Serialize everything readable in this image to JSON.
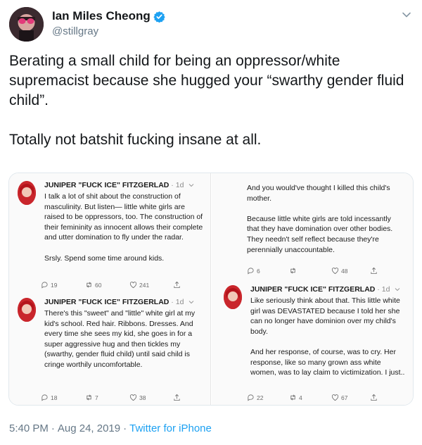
{
  "author": {
    "name": "Ian Miles Cheong",
    "handle": "@stillgray"
  },
  "tweet_text": "Berating a small child for being an oppressor/white supremacist because she hugged your “swarthy gender fluid child”.\n\nTotally not batshit fucking insane at all.",
  "embedded": {
    "author_name": "JUNIPER \"FUCK ICE\" FITZGERLAD",
    "time": "1d",
    "tweet1": {
      "text": "I talk a lot of shit about the construction of masculinity. But listen— little white girls are raised to be oppressors, too. The construction of their femininity as innocent allows their complete and utter domination to fly under the radar.\n\nSrsly. Spend some time around kids.",
      "replies": "19",
      "retweets": "60",
      "likes": "241"
    },
    "tweet2": {
      "text": "There's this \"sweet\" and \"little\" white girl at my kid's school. Red hair. Ribbons. Dresses. And every time she sees my kid, she goes in for a super aggressive hug and then tickles my (swarthy, gender fluid child) until said child is cringe worthily uncomfortable.",
      "replies": "18",
      "retweets": "7",
      "likes": "38"
    },
    "tweet3": {
      "text": "And you would've thought I killed this child's mother.\n\nBecause little white girls are told incessantly that they have domination over other bodies. They needn't self reflect because they're perennially unaccountable.",
      "replies": "6",
      "retweets": "",
      "likes": "48"
    },
    "tweet4": {
      "text": "Like seriously think about that. This little white girl was DEVASTATED because I told her she can no longer have dominion over my child's body.\n\nAnd her response, of course, was to cry. Her response, like so many grown ass white women, was to lay claim to victimization. I just..",
      "replies": "22",
      "retweets": "4",
      "likes": "67"
    }
  },
  "footer": {
    "time": "5:40 PM",
    "date": "Aug 24, 2019",
    "source": "Twitter for iPhone"
  },
  "colors": {
    "link": "#1da1f2",
    "verified": "#1da1f2",
    "muted": "#657786"
  }
}
